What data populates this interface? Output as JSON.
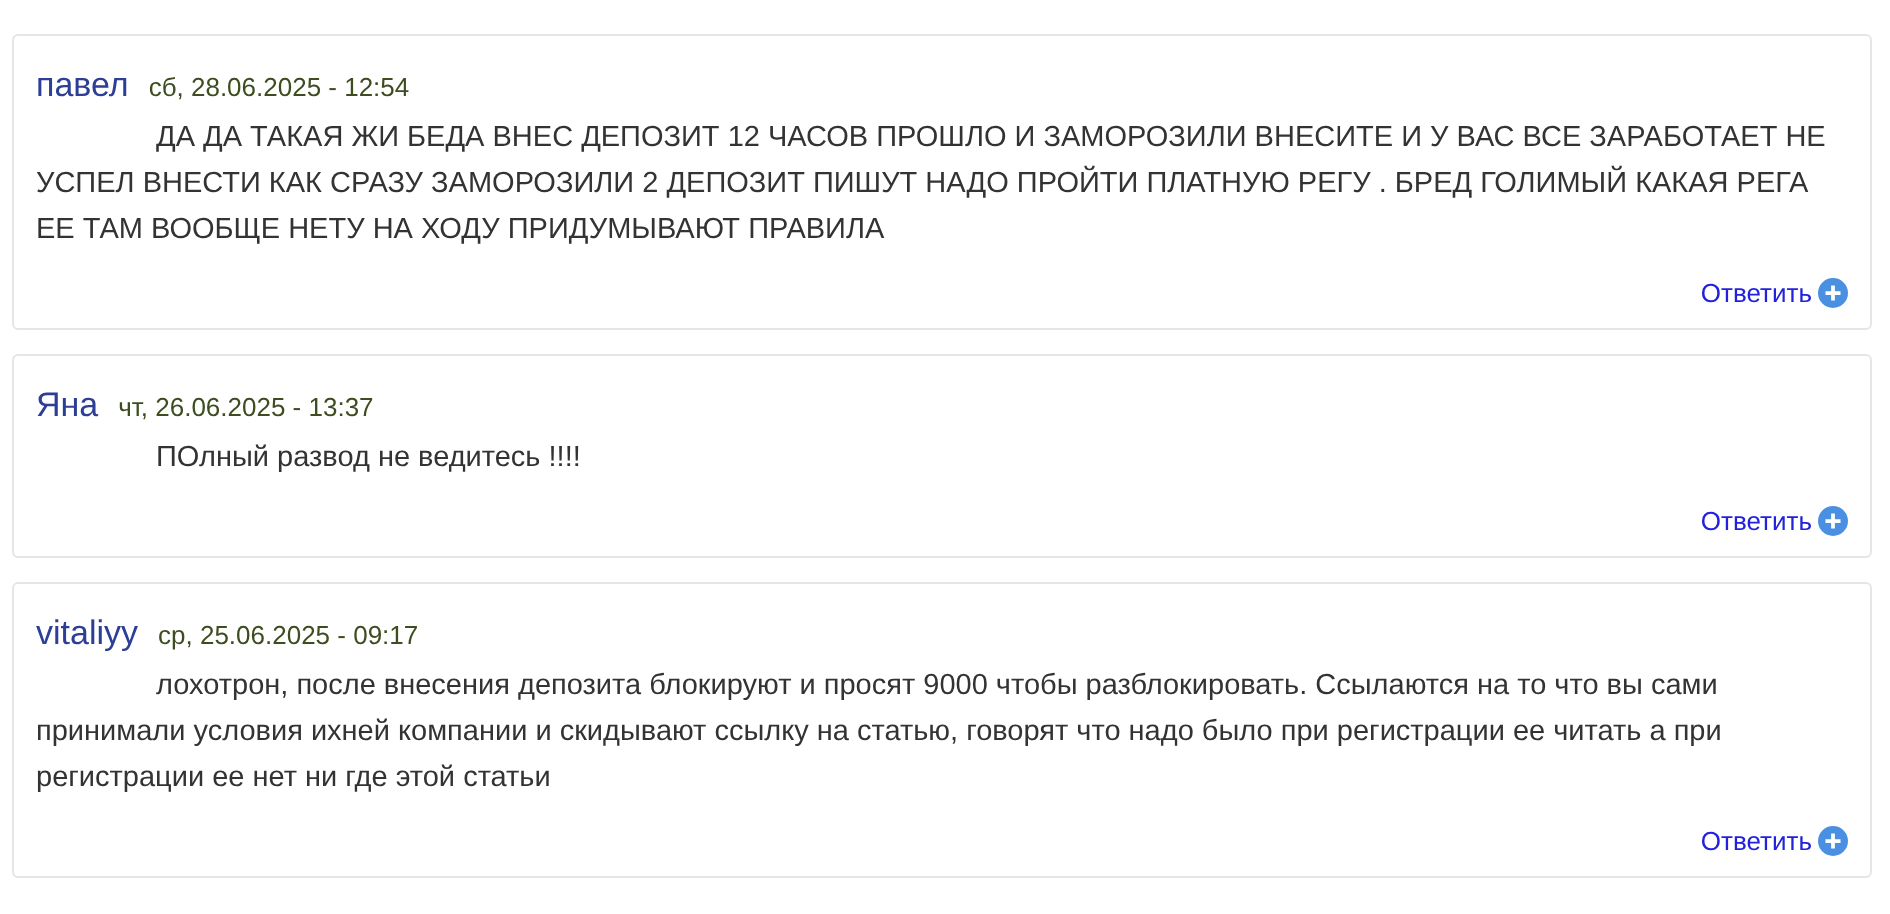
{
  "comments": [
    {
      "author": "павел",
      "date": "сб, 28.06.2025 - 12:54",
      "text": "ДА ДА ТАКАЯ ЖИ БЕДА ВНЕС ДЕПОЗИТ 12 ЧАСОВ ПРОШЛО И ЗАМОРОЗИЛИ ВНЕСИТЕ И У ВАС ВСЕ ЗАРАБОТАЕТ НЕ УСПЕЛ ВНЕСТИ КАК СРАЗУ ЗАМОРОЗИЛИ 2 ДЕПОЗИТ ПИШУТ НАДО ПРОЙТИ ПЛАТНУЮ РЕГУ . БРЕД ГОЛИМЫЙ КАКАЯ РЕГА ЕЕ ТАМ ВООБЩЕ НЕТУ НА ХОДУ ПРИДУМЫВАЮТ ПРАВИЛА",
      "reply": "Ответить"
    },
    {
      "author": "Яна",
      "date": "чт, 26.06.2025 - 13:37",
      "text": "ПОлный развод не ведитесь !!!!",
      "reply": "Ответить"
    },
    {
      "author": "vitaliyy",
      "date": "ср, 25.06.2025 - 09:17",
      "text": "лохотрон, после внесения депозита блокируют и просят 9000 чтобы разблокировать. Ссылаются на то что вы сами принимали условия ихней компании и скидывают ссылку на статью, говорят что надо было при регистрации ее читать а при регистрации ее нет ни где этой статьи",
      "reply": "Ответить"
    }
  ]
}
